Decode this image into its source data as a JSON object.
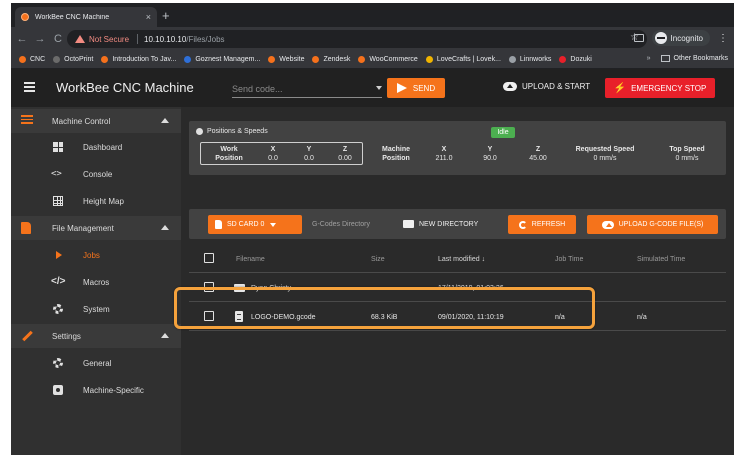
{
  "browser": {
    "tab_title": "WorkBee CNC Machine",
    "tab_close": "×",
    "new_tab": "+",
    "nav": {
      "back": "←",
      "forward": "→",
      "reload": "C"
    },
    "not_secure": "Not Secure",
    "url_host": "10.10.10.10",
    "url_path": "/Files/Jobs",
    "star": "☆",
    "incognito": "Incognito",
    "menu": "⋮",
    "bookmarks": [
      {
        "label": "CNC",
        "color": "#f5711c"
      },
      {
        "label": "OctoPrint",
        "color": "#6b6b6b"
      },
      {
        "label": "Introduction To Jav...",
        "color": "#f5711c"
      },
      {
        "label": "Goznest Managem...",
        "color": "#2e6fd8"
      },
      {
        "label": "Website",
        "color": "#f5711c"
      },
      {
        "label": "Zendesk",
        "color": "#f5711c"
      },
      {
        "label": "WooCommerce",
        "color": "#f5711c"
      },
      {
        "label": "LoveCrafts | Lovek...",
        "color": "#f0b400"
      },
      {
        "label": "Linnworks",
        "color": "#9aa0a6"
      },
      {
        "label": "Dozuki",
        "color": "#e8202a"
      }
    ],
    "bookmarks_more": "»",
    "other_bookmarks": "Other Bookmarks"
  },
  "header": {
    "title": "WorkBee CNC Machine",
    "send_code_placeholder": "Send code...",
    "send_label": "SEND",
    "upload_start_label": "UPLOAD & START",
    "estop_label": "EMERGENCY STOP",
    "estop_glyph": "⚡"
  },
  "sidebar": {
    "groups": [
      {
        "label": "Machine Control",
        "items": [
          "Dashboard",
          "Console",
          "Height Map"
        ]
      },
      {
        "label": "File Management",
        "items": [
          "Jobs",
          "Macros",
          "System"
        ]
      },
      {
        "label": "Settings",
        "items": [
          "General",
          "Machine-Specific"
        ]
      }
    ],
    "active_item": "Jobs"
  },
  "positions": {
    "title": "Positions & Speeds",
    "status": "Idle",
    "work_label_1": "Work",
    "work_label_2": "Position",
    "machine_label_1": "Machine",
    "machine_label_2": "Position",
    "axes": [
      "X",
      "Y",
      "Z"
    ],
    "work_values": [
      "0.0",
      "0.0",
      "0.00"
    ],
    "machine_values": [
      "211.0",
      "90.0",
      "45.00"
    ],
    "requested_speed_label": "Requested Speed",
    "requested_speed_value": "0 mm/s",
    "top_speed_label": "Top Speed",
    "top_speed_value": "0 mm/s"
  },
  "files": {
    "sd_card_label": "SD CARD 0",
    "directory_label": "G-Codes Directory",
    "new_directory_label": "NEW DIRECTORY",
    "refresh_label": "REFRESH",
    "upload_label": "UPLOAD G-CODE FILE(S)",
    "columns": {
      "filename": "Filename",
      "size": "Size",
      "last_modified": "Last modified",
      "sort_arrow": "↓",
      "job_time": "Job Time",
      "simulated_time": "Simulated Time"
    },
    "rows": [
      {
        "name": "Ryan Christy",
        "size": "",
        "modified": "17/11/2019, 01:03:26",
        "job_time": "",
        "simulated_time": ""
      },
      {
        "name": "LOGO-DEMO.gcode",
        "size": "68.3 KiB",
        "modified": "09/01/2020, 11:10:19",
        "job_time": "n/a",
        "simulated_time": "n/a"
      }
    ]
  },
  "colors": {
    "accent": "#f5731b",
    "estop": "#e8202a",
    "idle": "#4caf50",
    "highlight": "#f5a23c"
  }
}
